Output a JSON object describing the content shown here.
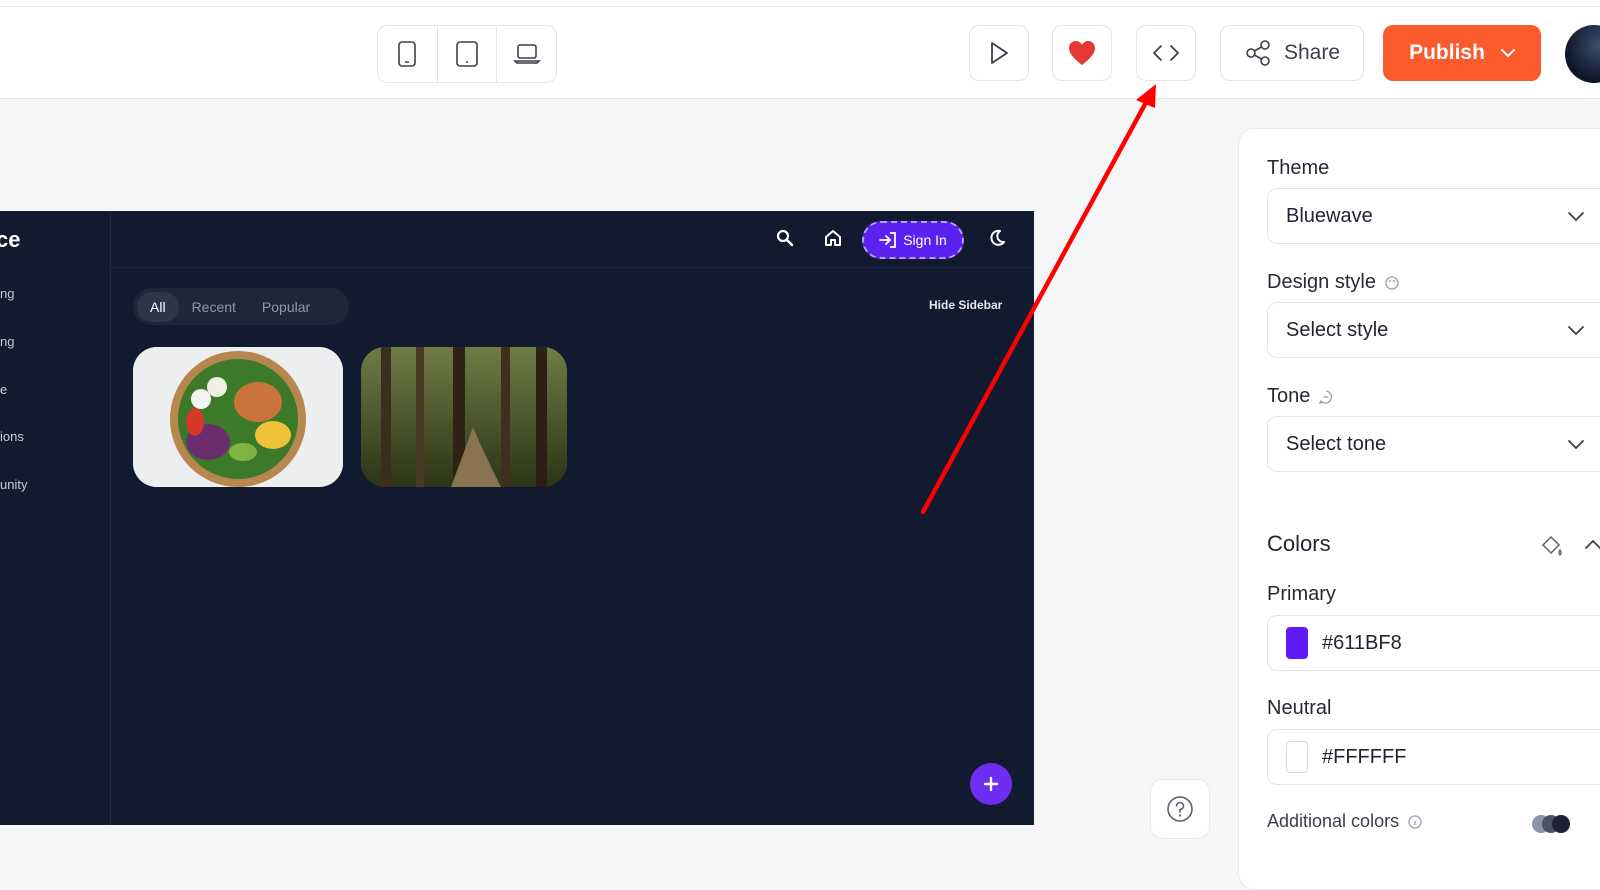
{
  "toolbar": {
    "devices": [
      "mobile-icon",
      "tablet-icon",
      "laptop-icon"
    ],
    "share_label": "Share",
    "publish_label": "Publish",
    "accent": "#FB5B2C",
    "heart_color": "#E53935"
  },
  "preview": {
    "brand_fragment": "ce",
    "sidebar_items": [
      "ng",
      "ng",
      "e",
      "ions",
      "unity"
    ],
    "signin_label": "Sign In",
    "tabs": [
      {
        "label": "All",
        "active": true
      },
      {
        "label": "Recent",
        "active": false
      },
      {
        "label": "Popular",
        "active": false
      }
    ],
    "hide_sidebar_label": "Hide Sidebar",
    "background": "#111A2E",
    "primary": "#611BF8"
  },
  "panel": {
    "theme_label": "Theme",
    "theme_value": "Bluewave",
    "design_style_label": "Design style",
    "design_style_value": "Select style",
    "tone_label": "Tone",
    "tone_value": "Select tone",
    "colors_title": "Colors",
    "primary_label": "Primary",
    "primary_value": "#611BF8",
    "neutral_label": "Neutral",
    "neutral_value": "#FFFFFF",
    "additional_label": "Additional colors"
  },
  "annotation": {
    "arrow_color": "#FF0000"
  }
}
